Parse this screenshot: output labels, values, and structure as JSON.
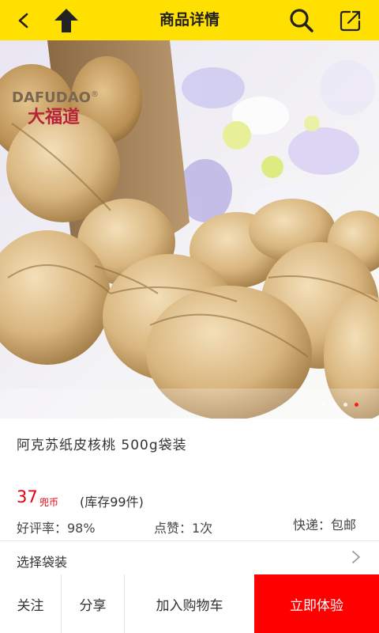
{
  "header": {
    "title": "商品详情",
    "back_icon": "chevron-left-icon",
    "up_icon": "arrow-up-icon",
    "search_icon": "search-icon",
    "share_icon": "share-icon",
    "bg_color": "#ffe000"
  },
  "hero": {
    "logo_en": "DAFUDAO",
    "logo_reg": "®",
    "logo_cn": "大福道",
    "slides": 4,
    "active_slide": 4
  },
  "product": {
    "name": "阿克苏纸皮核桃 500g袋装",
    "price": "37",
    "price_unit": "兜币",
    "stock": "(库存99件)",
    "rating": "好评率：98%",
    "likes": "点赞：1次",
    "shipping": "快递：包邮"
  },
  "options": {
    "select_label": "选择袋装"
  },
  "actions": {
    "follow": "关注",
    "share": "分享",
    "add_cart": "加入购物车",
    "buy_now": "立即体验",
    "accent": "#ff0000"
  }
}
